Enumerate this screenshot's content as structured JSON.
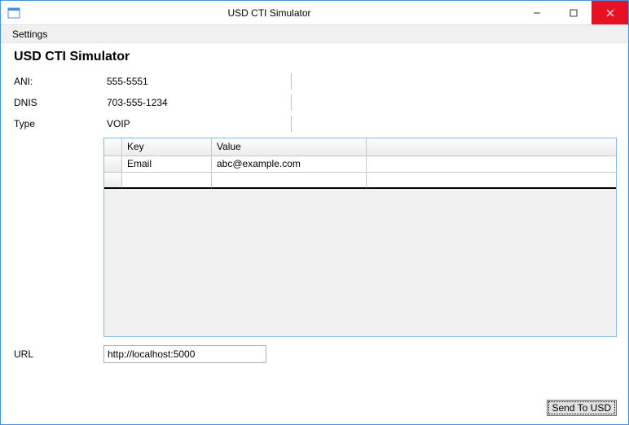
{
  "window": {
    "title": "USD CTI Simulator"
  },
  "menu": {
    "settings": "Settings"
  },
  "page": {
    "heading": "USD CTI Simulator"
  },
  "labels": {
    "ani": "ANI:",
    "dnis": "DNIS",
    "type": "Type",
    "url": "URL"
  },
  "fields": {
    "ani": "555-5551",
    "dnis": "703-555-1234",
    "type": "VOIP",
    "url": "http://localhost:5000"
  },
  "grid": {
    "headers": {
      "key": "Key",
      "value": "Value"
    },
    "rows": [
      {
        "key": "Email",
        "value": "abc@example.com"
      }
    ]
  },
  "buttons": {
    "send": "Send To USD"
  }
}
